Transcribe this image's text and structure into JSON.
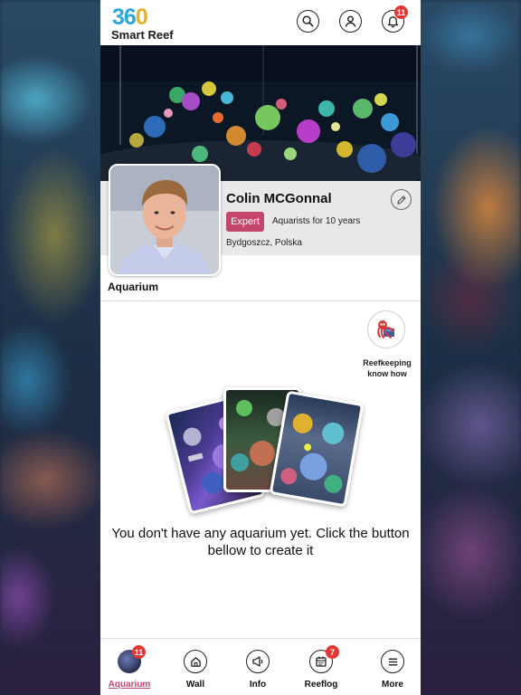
{
  "header": {
    "logo_number": "360",
    "logo_text": "Smart Reef",
    "notification_count": "11"
  },
  "profile": {
    "name": "Colin MCGonnal",
    "badge": "Expert",
    "experience": "Aquarists for 10  years",
    "location": "Bydgoszcz, Polska"
  },
  "section": {
    "title": "Aquarium",
    "reefkeeping_label_line1": "Reefkeeping",
    "reefkeeping_label_line2": "know how",
    "empty_line1": "You don't have any aquarium yet. Click the button",
    "empty_line2": "bellow to create it"
  },
  "tabs": [
    {
      "label": "Aquarium",
      "badge": "11",
      "active": true
    },
    {
      "label": "Wall"
    },
    {
      "label": "Info"
    },
    {
      "label": "Reeflog",
      "badge": "7"
    },
    {
      "label": "More"
    }
  ],
  "colors": {
    "accent": "#c3466b",
    "badge": "#e23636",
    "logo_blue": "#2aa6d8",
    "logo_gold": "#e0b32a"
  }
}
